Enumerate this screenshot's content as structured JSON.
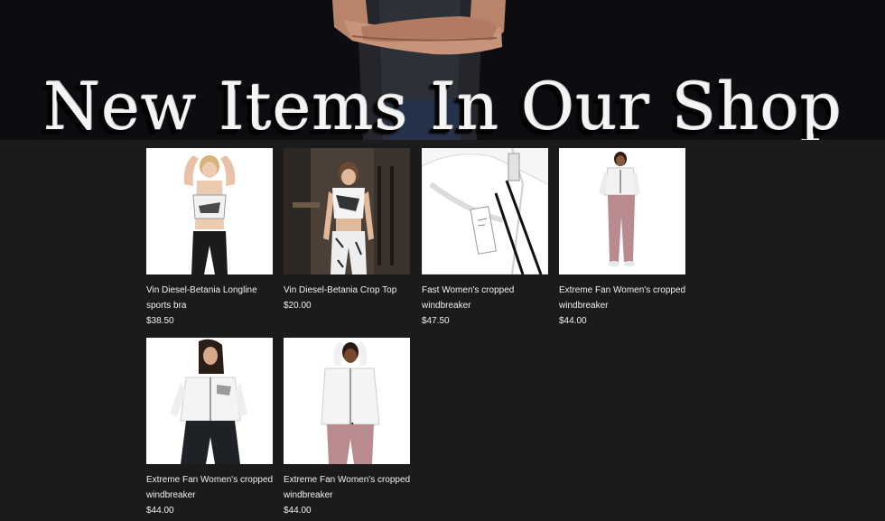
{
  "hero": {
    "title": "New Items In Our Shop"
  },
  "products": [
    {
      "name": "Vin Diesel-Betania Longline sports bra",
      "price": "$38.50",
      "image": "woman-white-sports-bra-black-leggings"
    },
    {
      "name": "Vin Diesel-Betania Crop Top",
      "price": "$20.00",
      "image": "woman-crop-top-gym"
    },
    {
      "name": "Fast Women's cropped windbreaker",
      "price": "$47.50",
      "image": "white-windbreaker-detail"
    },
    {
      "name": "Extreme Fan Women's cropped windbreaker",
      "price": "$44.00",
      "image": "woman-windbreaker-pink-leggings"
    },
    {
      "name": "Extreme Fan Women's cropped windbreaker",
      "price": "$44.00",
      "image": "woman-windbreaker-black-pants"
    },
    {
      "name": "Extreme Fan Women's cropped windbreaker",
      "price": "$44.00",
      "image": "woman-windbreaker-pink-leggings-hands-up"
    }
  ],
  "colors": {
    "page_background": "#1b1b1b",
    "hero_background": "#0c0d10",
    "text": "#f0f0f0"
  }
}
